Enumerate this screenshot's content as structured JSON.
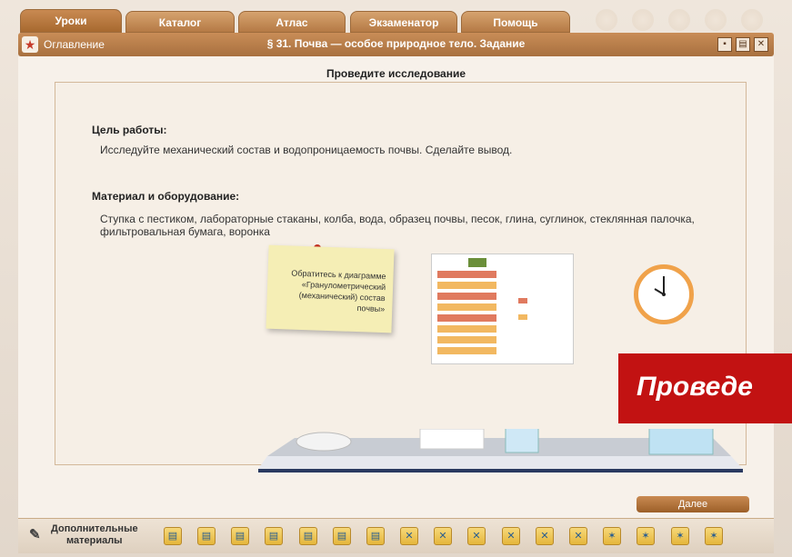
{
  "tabs": [
    {
      "label": "Уроки"
    },
    {
      "label": "Каталог"
    },
    {
      "label": "Атлас"
    },
    {
      "label": "Экзаменатор"
    },
    {
      "label": "Помощь"
    }
  ],
  "titlebar": {
    "toc_label": "Оглавление",
    "title": "§ 31. Почва — особое природное тело. Задание"
  },
  "content": {
    "subtitle": "Проведите исследование",
    "goal_heading": "Цель работы:",
    "goal_text": "Исследуйте механический состав и водопроницаемость почвы. Сделайте вывод.",
    "materials_heading": "Материал и оборудование:",
    "materials_text": "Ступка с пестиком, лабораторные стаканы, колба, вода, образец почвы, песок, глина, суглинок, стеклянная палочка, фильтровальная бумага, воронка",
    "note_text": "Обратитесь к диаграмме «Гранулометрический (механический) состав почвы»",
    "next_label": "Далее",
    "banner_text": "Проведе"
  },
  "bottom": {
    "more_label_1": "Дополнительные",
    "more_label_2": "материалы"
  },
  "colors": {
    "accent": "#b57a45",
    "banner": "#c21212"
  }
}
